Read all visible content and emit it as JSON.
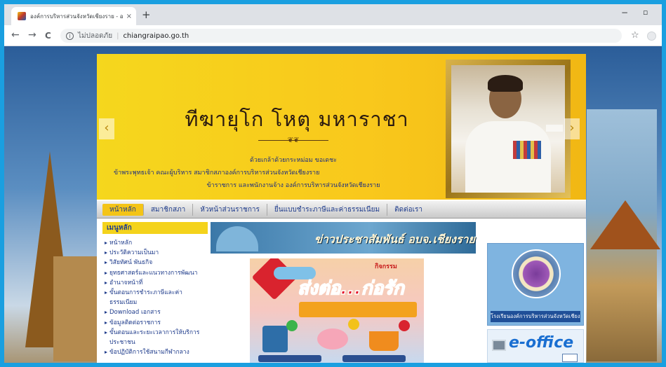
{
  "browser": {
    "tab_title": "องค์การบริหารส่วนจังหวัดเชียงราย - อ...",
    "tab_close": "×",
    "new_tab": "+",
    "minimize": "−",
    "restore": "▫",
    "back": "←",
    "forward": "→",
    "reload": "C",
    "info_glyph": "i",
    "security_text": "ไม่ปลอดภัย",
    "separator": "|",
    "url": "chiangraipao.go.th",
    "bookmark_star": "☆"
  },
  "banner": {
    "title": "ทีฆายุโก โหตุ มหาราชา",
    "ornament": "❦❦",
    "line1": "ด้วยเกล้าด้วยกระหม่อม ขอเดชะ",
    "line2": "ข้าพระพุทธเจ้า คณะผู้บริหาร สมาชิกสภาองค์การบริหารส่วนจังหวัดเชียงราย",
    "line3": "ข้าราชการ และพนักงานจ้าง องค์การบริหารส่วนจังหวัดเชียงราย",
    "prev_arrow": "‹",
    "next_arrow": "›"
  },
  "navbar": {
    "items": [
      {
        "label": "หน้าหลัก",
        "active": true
      },
      {
        "label": "สมาชิกสภา",
        "active": false
      },
      {
        "label": "หัวหน้าส่วนราชการ",
        "active": false
      },
      {
        "label": "ยื่นแบบชำระภาษีและค่าธรรมเนียม",
        "active": false
      },
      {
        "label": "ติดต่อเรา",
        "active": false
      }
    ]
  },
  "sidebar": {
    "heading": "เมนูหลัก",
    "items": [
      "หน้าหลัก",
      "ประวัติความเป็นมา",
      "วิสัยทัศน์ พันธกิจ",
      "ยุทธศาสตร์และแนวทางการพัฒนา",
      "อำนาจหน้าที่",
      "ขั้นตอนการชำระภาษีและค่าธรรมเนียม",
      "Download เอกสาร",
      "ข้อมูลติดต่อราชการ",
      "ขั้นตอนและระยะเวลาการให้บริการประชาชน",
      "ข้อปฏิบัติการใช้สนามกีฬากลาง"
    ]
  },
  "center": {
    "news_title": "ข่าวประชาสัมพันธ์ อบจ.เชียงราย",
    "poster_tag": "กิจกรรม",
    "poster_title": "ส่งต่อ...ก่อรัก"
  },
  "right": {
    "seal_label": "โรงเรียนองค์การบริหารส่วนจังหวัดเชียงราย",
    "eoffice_label": "e-office"
  },
  "colors": {
    "browser_accent": "#1a9fe0",
    "banner_yellow": "#f5d71d",
    "nav_active": "#f4c417",
    "link_blue": "#1f3c8c"
  }
}
